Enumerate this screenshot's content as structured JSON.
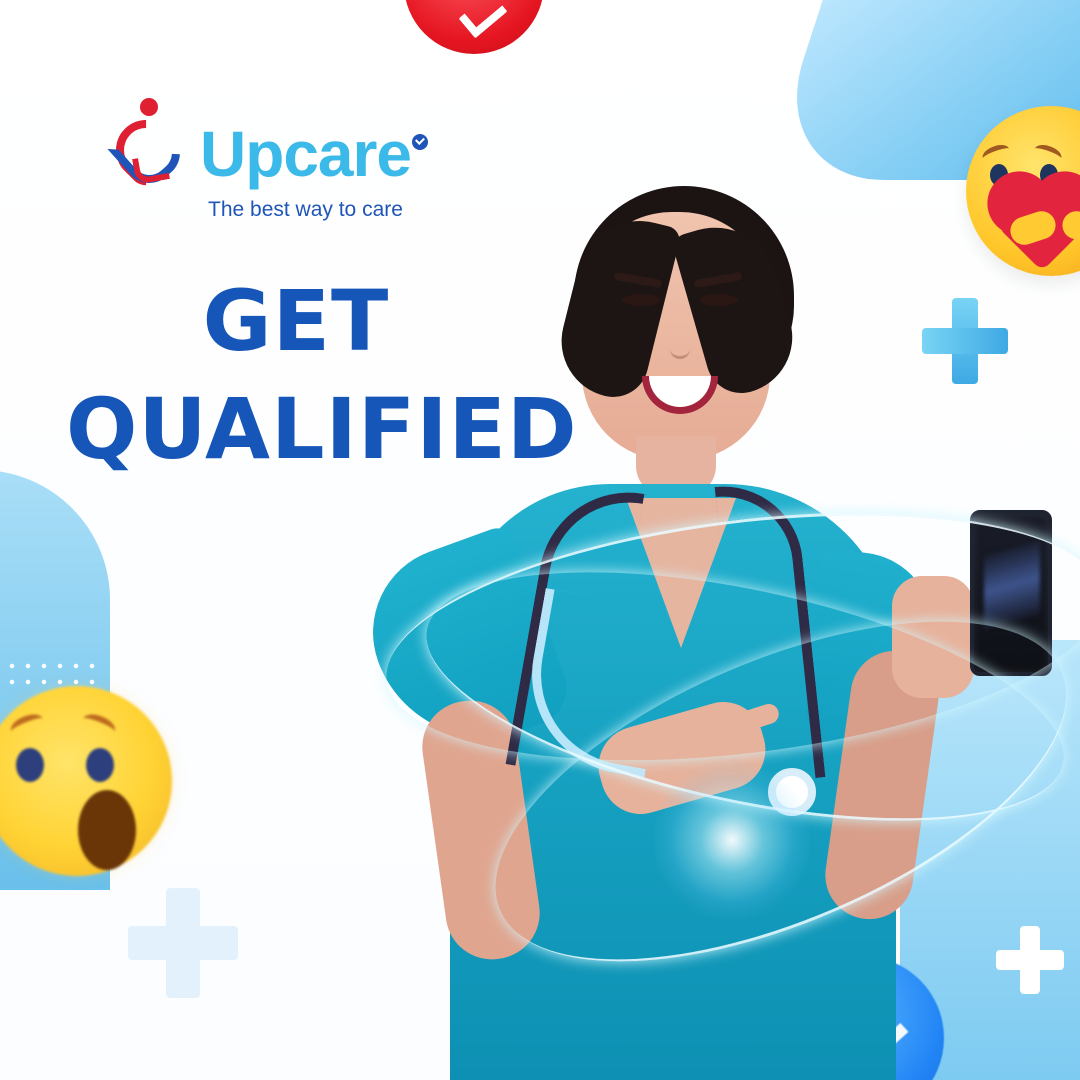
{
  "brand": {
    "name": "Upcare",
    "tagline": "The best way to care"
  },
  "hero": {
    "line1": "GET",
    "line2": "QUALIFIED"
  },
  "icons": {
    "logo": "heart-care-logo-icon",
    "verified": "verified-badge-icon",
    "care_reaction": "care-reaction-icon",
    "wow_reaction": "wow-reaction-icon",
    "love_reaction": "love-reaction-icon",
    "like_reaction": "like-reaction-icon",
    "plus": "plus-icon",
    "phone": "smartphone-icon",
    "stethoscope": "stethoscope-icon"
  },
  "colors": {
    "brand_blue": "#1556b8",
    "brand_cyan": "#3bb9e8",
    "brand_red": "#df1f32",
    "scrubs": "#18a5c5",
    "light_blue": "#7bcaf3"
  }
}
